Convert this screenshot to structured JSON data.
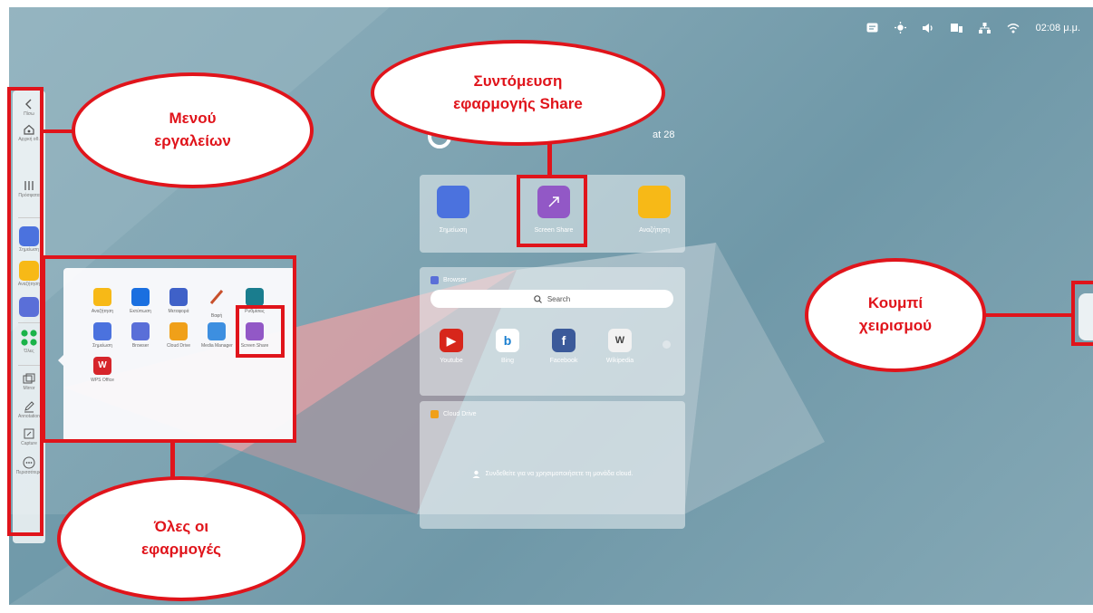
{
  "status_bar": {
    "time": "02:08 μ.μ.",
    "icons": [
      "caption-icon",
      "brightness-icon",
      "volume-icon",
      "display-icon",
      "network-icon",
      "wifi-icon"
    ]
  },
  "clock_partial": "at 28",
  "toolbar": {
    "items": [
      {
        "name": "back",
        "label": "Πίσω"
      },
      {
        "name": "home",
        "label": "Αρχική οθ."
      },
      {
        "name": "recent",
        "label": "Πρόσφατα"
      },
      {
        "name": "annotate",
        "label": "Σημείωση"
      },
      {
        "name": "files",
        "label": "Αναζήτηση"
      },
      {
        "name": "browser",
        "label": ""
      },
      {
        "name": "all-apps",
        "label": "Όλες"
      },
      {
        "name": "mirror",
        "label": "Mirror"
      },
      {
        "name": "annotation",
        "label": "Annotation"
      },
      {
        "name": "capture",
        "label": "Capture"
      },
      {
        "name": "more",
        "label": "Περισσότερα"
      }
    ]
  },
  "apps_popup": {
    "items": [
      {
        "label": "Αναζήτηση",
        "color": "#f7b917"
      },
      {
        "label": "Εκτύπωση",
        "color": "#1a6fe0"
      },
      {
        "label": "Μεταφορά",
        "color": "#3f61c8"
      },
      {
        "label": "Βαφή",
        "color": "#c8502c"
      },
      {
        "label": "Ρυθμίσεις",
        "color": "#1a7d8e"
      },
      {
        "label": "Σημείωση",
        "color": "#4b72de"
      },
      {
        "label": "Browser",
        "color": "#5a6fd8"
      },
      {
        "label": "Cloud Drive",
        "color": "#f0a019"
      },
      {
        "label": "Media Manager",
        "color": "#3d8fe0"
      },
      {
        "label": "Screen Share",
        "color": "#9258c6"
      },
      {
        "label": "WPS Office",
        "color": "#d6252b"
      }
    ]
  },
  "shortcut_card": {
    "apps": [
      {
        "label": "Σημείωση",
        "color": "#4b72de"
      },
      {
        "label": "Screen Share",
        "color": "#9258c6"
      },
      {
        "label": "Αναζήτηση",
        "color": "#f7b917"
      }
    ]
  },
  "browser_card": {
    "title": "Browser",
    "search_placeholder": "Search",
    "links": [
      {
        "label": "Youtube",
        "glyph": "▶",
        "color": "#d7261b"
      },
      {
        "label": "Bing",
        "glyph": "b",
        "color": "#ffffff"
      },
      {
        "label": "Facebook",
        "glyph": "f",
        "color": "#3b5a9a"
      },
      {
        "label": "Wikipedia",
        "glyph": "W",
        "color": "#f2f2f2"
      }
    ]
  },
  "cloud_card": {
    "title": "Cloud Drive",
    "message": "Συνδεθείτε για να χρησιμοποιήσετε τη μονάδα cloud."
  },
  "callouts": {
    "tools_line1": "Μενού",
    "tools_line2": "εργαλείων",
    "share_line1": "Συντόμευση",
    "share_line2": "εφαρμογής Share",
    "handle_line1": "Κουμπί",
    "handle_line2": "χειρισμού",
    "allapps_line1": "Όλες οι",
    "allapps_line2": "εφαρμογές"
  }
}
